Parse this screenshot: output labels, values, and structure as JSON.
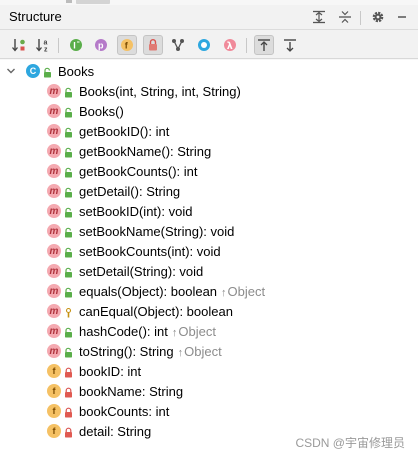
{
  "panel": {
    "title": "Structure"
  },
  "tree": {
    "root": {
      "label": "Books",
      "icon": "class-icon"
    },
    "items": [
      {
        "kind": "method",
        "access": "public",
        "label": "Books(int, String, int, String)",
        "super": ""
      },
      {
        "kind": "method",
        "access": "public",
        "label": "Books()",
        "super": ""
      },
      {
        "kind": "method",
        "access": "public",
        "label": "getBookID(): int",
        "super": ""
      },
      {
        "kind": "method",
        "access": "public",
        "label": "getBookName(): String",
        "super": ""
      },
      {
        "kind": "method",
        "access": "public",
        "label": "getBookCounts(): int",
        "super": ""
      },
      {
        "kind": "method",
        "access": "public",
        "label": "getDetail(): String",
        "super": ""
      },
      {
        "kind": "method",
        "access": "public",
        "label": "setBookID(int): void",
        "super": ""
      },
      {
        "kind": "method",
        "access": "public",
        "label": "setBookName(String): void",
        "super": ""
      },
      {
        "kind": "method",
        "access": "public",
        "label": "setBookCounts(int): void",
        "super": ""
      },
      {
        "kind": "method",
        "access": "public",
        "label": "setDetail(String): void",
        "super": ""
      },
      {
        "kind": "method",
        "access": "public",
        "label": "equals(Object): boolean",
        "super": "Object"
      },
      {
        "kind": "method",
        "access": "protected",
        "label": "canEqual(Object): boolean",
        "super": ""
      },
      {
        "kind": "method",
        "access": "public",
        "label": "hashCode(): int",
        "super": "Object"
      },
      {
        "kind": "method",
        "access": "public",
        "label": "toString(): String",
        "super": "Object"
      },
      {
        "kind": "field",
        "access": "private",
        "label": "bookID: int",
        "super": ""
      },
      {
        "kind": "field",
        "access": "private",
        "label": "bookName: String",
        "super": ""
      },
      {
        "kind": "field",
        "access": "private",
        "label": "bookCounts: int",
        "super": ""
      },
      {
        "kind": "field",
        "access": "private",
        "label": "detail: String",
        "super": ""
      }
    ]
  },
  "watermark": "CSDN @宇宙修理员",
  "colors": {
    "method_icon": "#f4a9b0",
    "field_icon": "#f5c164",
    "class_icon": "#2ea7df",
    "public_lock": "#5aae4a",
    "private_lock": "#d9534f",
    "protected_lock": "#c69214",
    "inherited_text": "#8c8c8c"
  }
}
